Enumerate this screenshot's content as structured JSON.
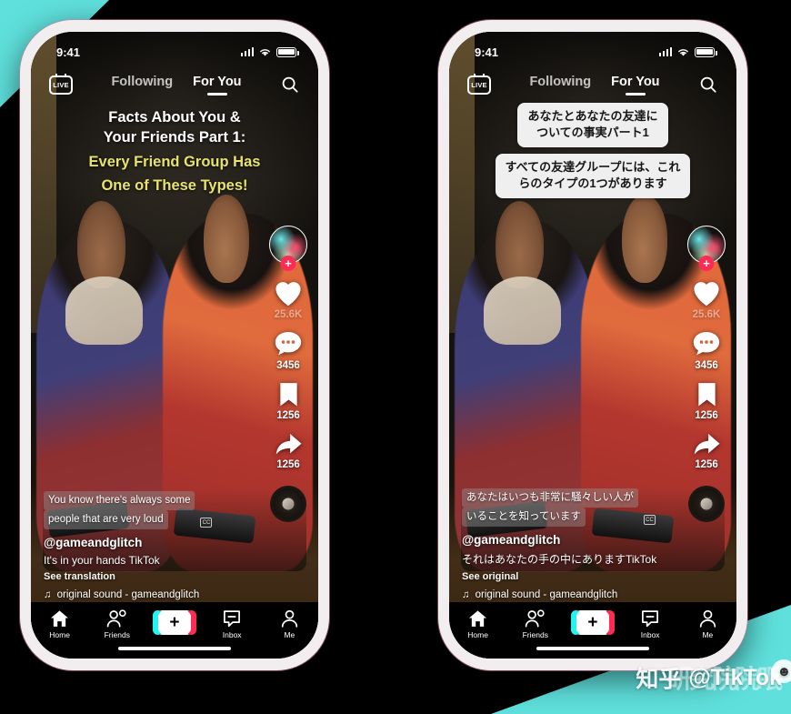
{
  "background": {
    "teal_color": "#5FE0DC",
    "base_color": "#000000"
  },
  "watermark": {
    "platform": "知乎",
    "handle": "@TikTok",
    "ghost_text": "研究院院眠",
    "logo_icon": "zhihu-logo-icon"
  },
  "phones": [
    {
      "id": "left",
      "variant": "original-english",
      "status_bar": {
        "time": "9:41",
        "signal_icon": "cellular-signal-icon",
        "wifi_icon": "wifi-icon",
        "battery_icon": "battery-full-icon"
      },
      "top_nav": {
        "live_label": "LIVE",
        "tabs": [
          {
            "label": "Following",
            "active": false
          },
          {
            "label": "For You",
            "active": true
          }
        ],
        "search_icon": "search-icon"
      },
      "video_overlay": {
        "translated": false,
        "line_white_1": "Facts About You &",
        "line_white_2": "Your Friends Part 1:",
        "line_yellow_1": "Every Friend Group Has",
        "line_yellow_2": "One of These Types!",
        "white_color": "#ffffff",
        "yellow_color": "#e9e36a"
      },
      "action_rail": {
        "avatar_icon": "creator-avatar",
        "follow_icon": "plus-follow-icon",
        "follow_color": "#fe2c55",
        "like": {
          "icon": "heart-icon",
          "count": "25.6K"
        },
        "comment": {
          "icon": "comment-bubble-icon",
          "count": "3456"
        },
        "bookmark": {
          "icon": "bookmark-icon",
          "count": "1256"
        },
        "share": {
          "icon": "share-arrow-icon",
          "count": "1256"
        },
        "sound_disc_icon": "spinning-record-icon"
      },
      "info": {
        "subtitle_line_1": "You know there's always some",
        "subtitle_line_2": "people that are very loud",
        "cc_badge": "CC",
        "handle": "@gameandglitch",
        "description": "It's in your hands TikTok",
        "translate_link": "See translation",
        "sound_icon": "music-note-icon",
        "sound_name": "original sound - gameandglitch"
      },
      "tab_bar": [
        {
          "label": "Home",
          "icon": "home-icon"
        },
        {
          "label": "Friends",
          "icon": "friends-icon"
        },
        {
          "label": "+",
          "icon": "create-plus-icon"
        },
        {
          "label": "Inbox",
          "icon": "inbox-icon"
        },
        {
          "label": "Me",
          "icon": "profile-icon"
        }
      ]
    },
    {
      "id": "right",
      "variant": "translated-japanese",
      "status_bar": {
        "time": "9:41",
        "signal_icon": "cellular-signal-icon",
        "wifi_icon": "wifi-icon",
        "battery_icon": "battery-full-icon"
      },
      "top_nav": {
        "live_label": "LIVE",
        "tabs": [
          {
            "label": "Following",
            "active": false
          },
          {
            "label": "For You",
            "active": true
          }
        ],
        "search_icon": "search-icon"
      },
      "video_overlay": {
        "translated": true,
        "bubble_1_line_1": "あなたとあなたの友達に",
        "bubble_1_line_2": "ついての事実パート1",
        "bubble_2_line_1": "すべての友達グループには、これ",
        "bubble_2_line_2": "らのタイプの1つがあります",
        "bubble_bg": "#efefef",
        "bubble_text_color": "#161616"
      },
      "action_rail": {
        "avatar_icon": "creator-avatar",
        "follow_icon": "plus-follow-icon",
        "follow_color": "#fe2c55",
        "like": {
          "icon": "heart-icon",
          "count": "25.6K"
        },
        "comment": {
          "icon": "comment-bubble-icon",
          "count": "3456"
        },
        "bookmark": {
          "icon": "bookmark-icon",
          "count": "1256"
        },
        "share": {
          "icon": "share-arrow-icon",
          "count": "1256"
        },
        "sound_disc_icon": "spinning-record-icon"
      },
      "info": {
        "subtitle_line_1": "あなたはいつも非常に騒々しい人が",
        "subtitle_line_2": "いることを知っています",
        "cc_badge": "CC",
        "handle": "@gameandglitch",
        "description": "それはあなたの手の中にありますTikTok",
        "translate_link": "See original",
        "sound_icon": "music-note-icon",
        "sound_name": "original sound - gameandglitch"
      },
      "tab_bar": [
        {
          "label": "Home",
          "icon": "home-icon"
        },
        {
          "label": "Friends",
          "icon": "friends-icon"
        },
        {
          "label": "+",
          "icon": "create-plus-icon"
        },
        {
          "label": "Inbox",
          "icon": "inbox-icon"
        },
        {
          "label": "Me",
          "icon": "profile-icon"
        }
      ]
    }
  ]
}
